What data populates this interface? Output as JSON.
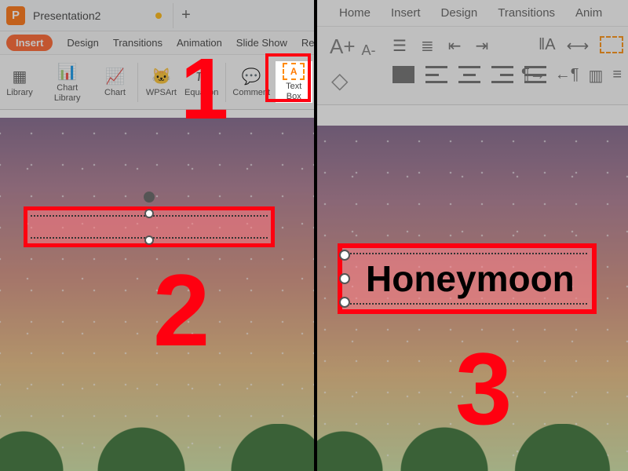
{
  "app": {
    "logo_letter": "P",
    "doc_title": "Presentation2",
    "new_tab_glyph": "+"
  },
  "tabs_left": {
    "insert": "Insert",
    "design": "Design",
    "transitions": "Transitions",
    "animation": "Animation",
    "slideshow": "Slide Show",
    "review": "Review"
  },
  "ribbon_left": {
    "library": "Library",
    "chart_library": "Chart Library",
    "chart": "Chart",
    "wpsart": "WPSArt",
    "equation": "Equation",
    "comment": "Comment",
    "textbox": "Text Box"
  },
  "tabs_right": {
    "home": "Home",
    "insert": "Insert",
    "design": "Design",
    "transitions": "Transitions",
    "anim": "Anim"
  },
  "ribbon_right": {
    "inc_font_glyph": "A+",
    "dec_font_glyph": "A-"
  },
  "text_content": "Honeymoon",
  "annotations": {
    "n1": "1",
    "n2": "2",
    "n3": "3"
  }
}
